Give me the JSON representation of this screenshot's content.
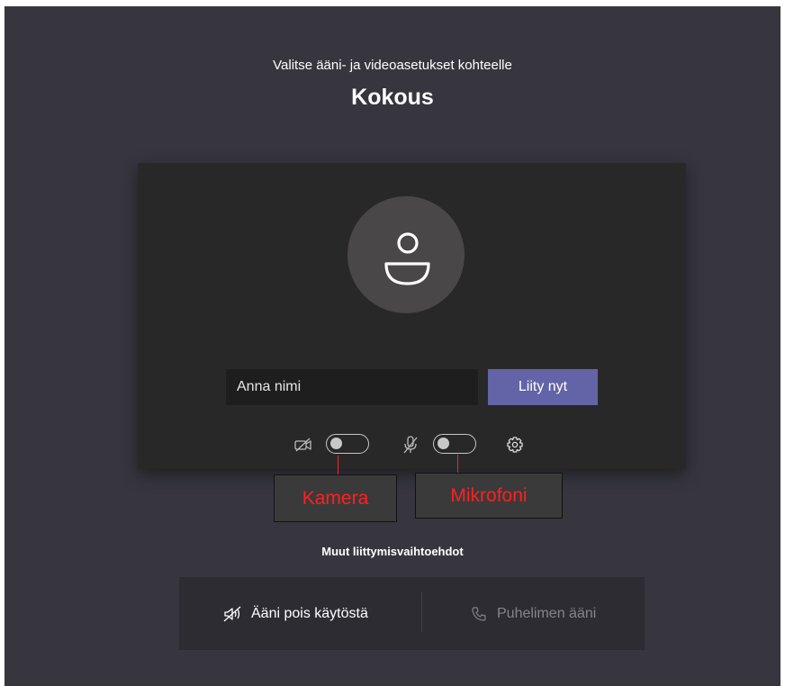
{
  "header": {
    "subtitle": "Valitse ääni- ja videoasetukset kohteelle",
    "title": "Kokous"
  },
  "card": {
    "avatar_icon": "person-icon",
    "name_input": {
      "placeholder": "Anna nimi",
      "value": ""
    },
    "join_button": "Liity nyt",
    "camera": {
      "icon": "camera-off-icon",
      "enabled": false
    },
    "microphone": {
      "icon": "mic-off-icon",
      "enabled": false
    },
    "settings_icon": "gear-icon"
  },
  "annotations": {
    "camera_label": "Kamera",
    "microphone_label": "Mikrofoni",
    "color": "#ff2020"
  },
  "other_options": {
    "title": "Muut liittymisvaihtoehdot",
    "audio_off": {
      "label": "Ääni pois käytöstä",
      "icon": "speaker-off-icon"
    },
    "phone_audio": {
      "label": "Puhelimen ääni",
      "icon": "phone-icon",
      "disabled": true
    }
  },
  "colors": {
    "background": "#37363f",
    "card": "#292829",
    "accent": "#6264a7"
  }
}
